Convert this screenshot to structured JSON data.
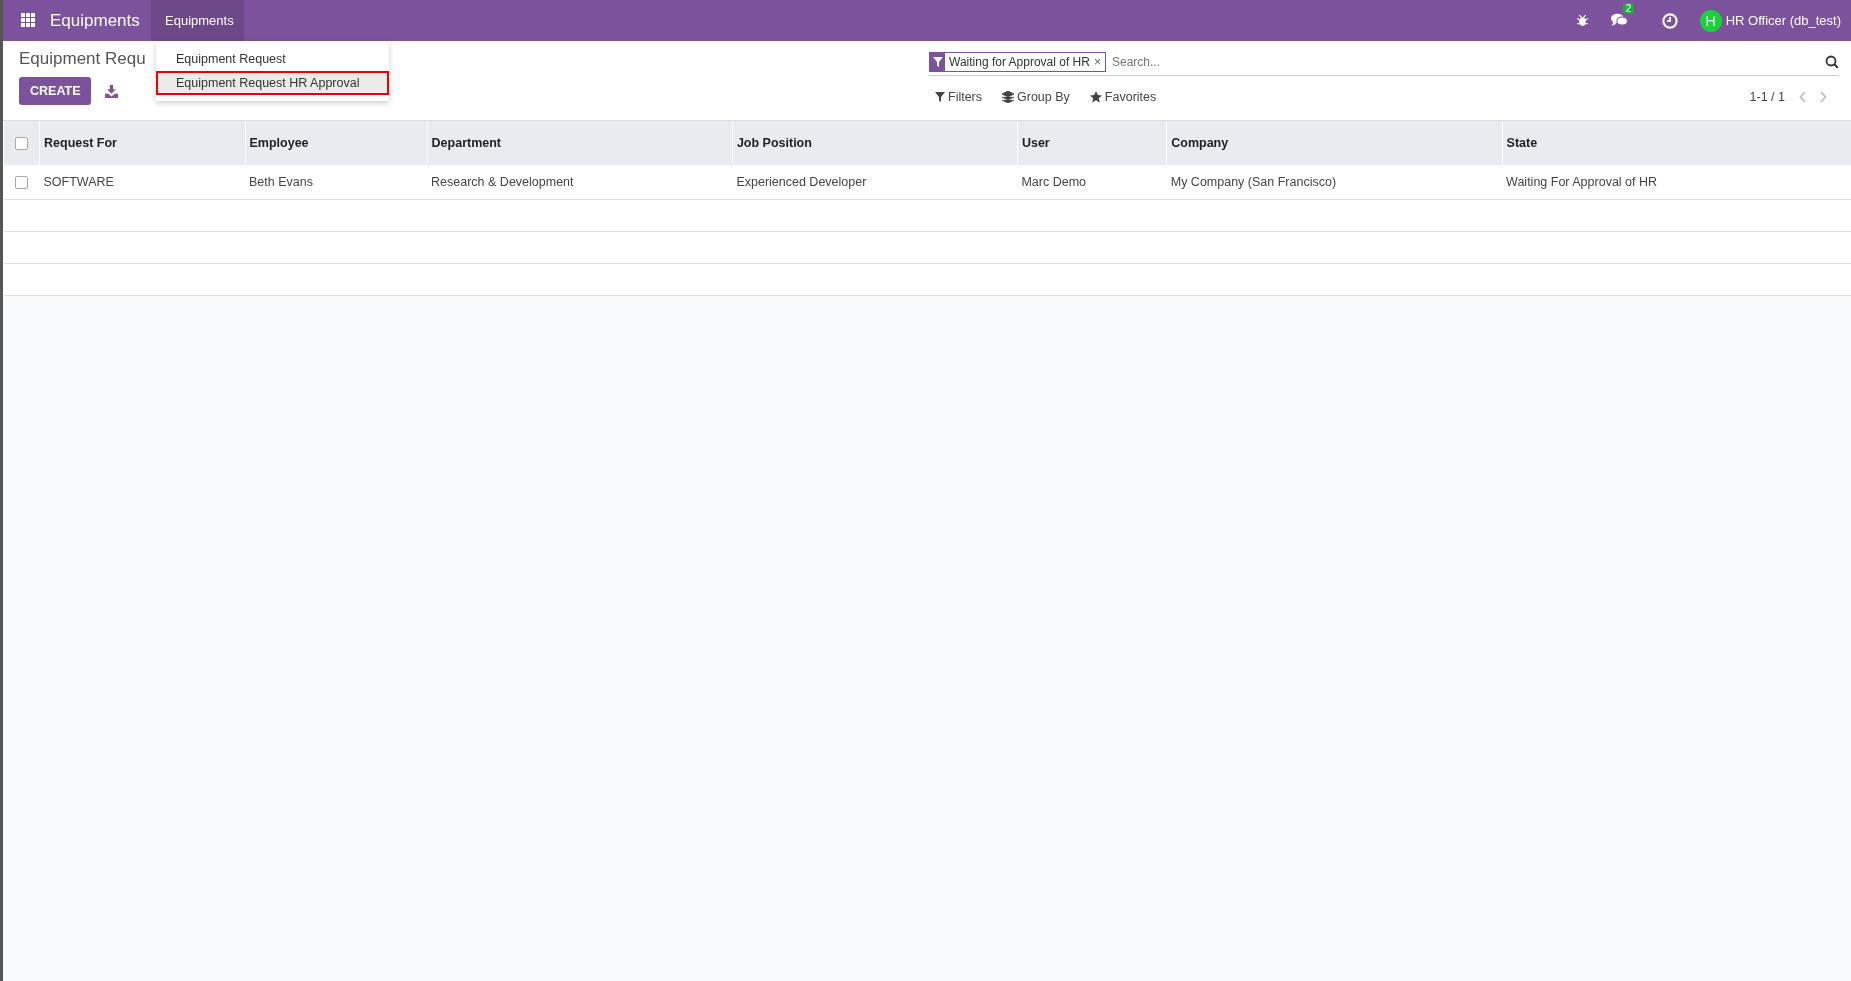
{
  "navbar": {
    "app_name": "Equipments",
    "menus": [
      {
        "label": "Equipments",
        "open": true
      }
    ],
    "chat_count": "2",
    "user_initial": "H",
    "user_name": "HR Officer (db_test)"
  },
  "dropdown": {
    "items": [
      {
        "label": "Equipment Request",
        "selected": false
      },
      {
        "label": "Equipment Request HR Approval",
        "selected": true
      }
    ]
  },
  "breadcrumb": "Equipment Requ",
  "create_button": "CREATE",
  "search": {
    "facet": "Waiting for Approval of HR",
    "remove": "×",
    "placeholder": "Search..."
  },
  "search_options": [
    "Filters",
    "Group By",
    "Favorites"
  ],
  "pager": "1-1 / 1",
  "table": {
    "select_all_checked": false,
    "columns": [
      "Request For",
      "Employee",
      "Department",
      "Job Position",
      "User",
      "Company",
      "State"
    ],
    "rows": [
      {
        "checked": false,
        "cells": [
          "SOFTWARE",
          "Beth Evans",
          "Research & Development",
          "Experienced Developer",
          "Marc Demo",
          "My Company (San Francisco)",
          "Waiting For Approval of HR"
        ]
      }
    ]
  }
}
